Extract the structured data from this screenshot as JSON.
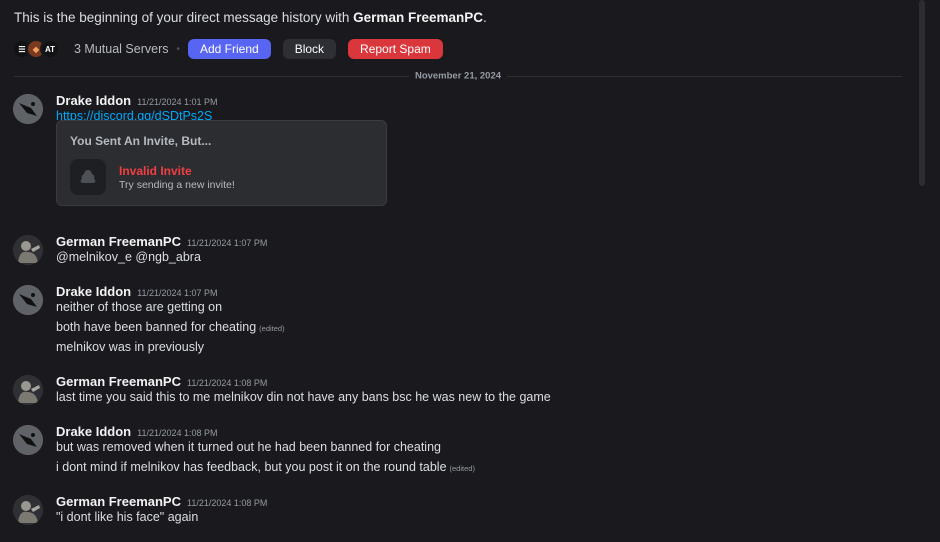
{
  "header": {
    "intro_prefix": "This is the beginning of your direct message history with ",
    "intro_name": "German FreemanPC",
    "intro_suffix": "."
  },
  "actions": {
    "server_icons": [
      "☰",
      "◆",
      "AT"
    ],
    "mutual_servers": "3 Mutual Servers",
    "separator": "•",
    "add_friend": "Add Friend",
    "block": "Block",
    "report_spam": "Report Spam"
  },
  "divider": {
    "date": "November 21, 2024"
  },
  "messages": [
    {
      "user": "Drake Iddon",
      "time": "11/21/2024 1:01 PM",
      "lines": [
        "https://discord.gg/dSDtPs2S"
      ],
      "invite": {
        "title": "You Sent An Invite, But...",
        "name": "Invalid Invite",
        "subtitle": "Try sending a new invite!"
      }
    },
    {
      "user": "German FreemanPC",
      "time": "11/21/2024 1:07 PM",
      "lines": [
        "@melnikov_e @ngb_abra"
      ]
    },
    {
      "user": "Drake Iddon",
      "time": "11/21/2024 1:07 PM",
      "lines": [
        "neither of those are getting on",
        "both have been banned for cheating",
        "melnikov was in previously"
      ],
      "edited_label": "(edited)"
    },
    {
      "user": "German FreemanPC",
      "time": "11/21/2024 1:08 PM",
      "lines": [
        "last time you said this to me melnikov din not have any bans bsc he was new to the game"
      ]
    },
    {
      "user": "Drake Iddon",
      "time": "11/21/2024 1:08 PM",
      "lines": [
        "but was removed when it turned out he had been banned for cheating",
        "i dont mind if melnikov has feedback, but you post it on the round table"
      ],
      "edited_label": "(edited)"
    },
    {
      "user": "German FreemanPC",
      "time": "11/21/2024 1:08 PM",
      "lines": [
        "\"i dont like his face\" again"
      ]
    }
  ]
}
